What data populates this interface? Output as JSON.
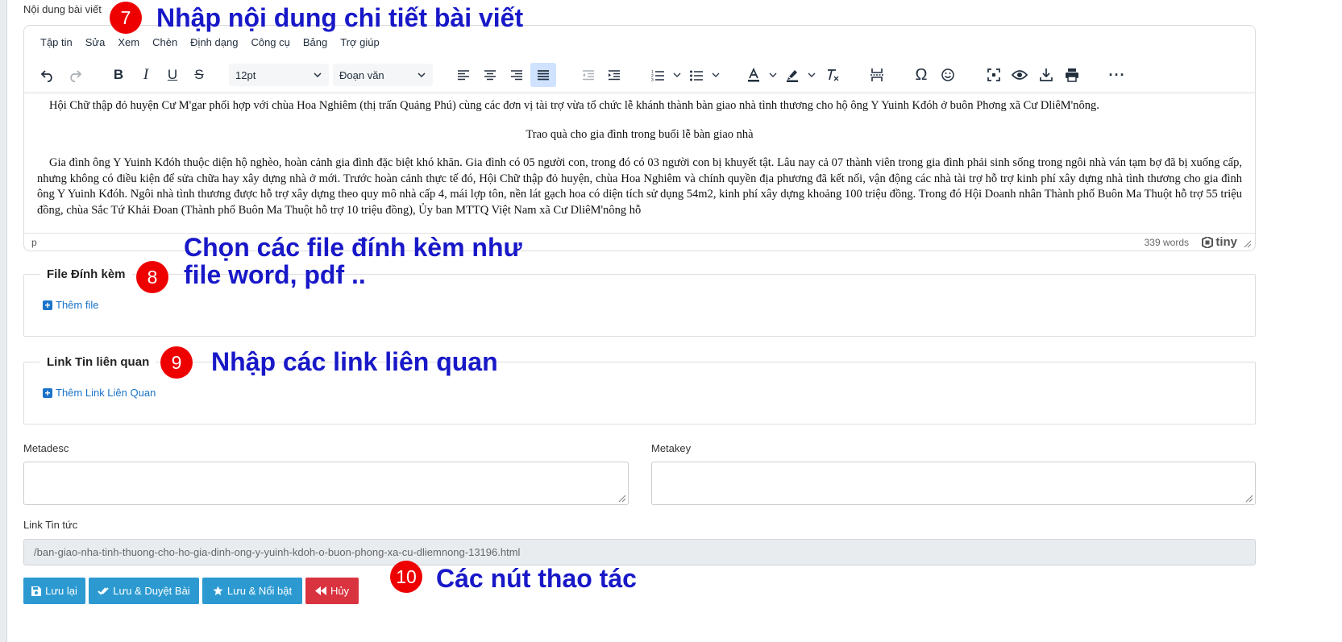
{
  "editor_section": {
    "label": "Nội dung bài viết",
    "menu": [
      "Tập tin",
      "Sửa",
      "Xem",
      "Chèn",
      "Định dạng",
      "Công cụ",
      "Bảng",
      "Trợ giúp"
    ],
    "font_size": "12pt",
    "block_format": "Đoạn văn",
    "toolbar_icons": [
      "undo-icon",
      "redo-icon",
      "bold-icon",
      "italic-icon",
      "underline-icon",
      "strikethrough-icon",
      "align-left-icon",
      "align-center-icon",
      "align-right-icon",
      "align-justify-icon",
      "outdent-icon",
      "indent-icon",
      "numbered-list-icon",
      "bullet-list-icon",
      "text-color-icon",
      "highlight-icon",
      "clear-format-icon",
      "page-break-icon",
      "special-char-icon",
      "emoticon-icon",
      "fullscreen-icon",
      "preview-icon",
      "save-icon",
      "print-icon",
      "more-icon"
    ],
    "paragraphs": [
      "Hội Chữ thập đỏ huyện Cư M'gar phối hợp với chùa Hoa Nghiêm (thị trấn Quảng Phú) cùng các đơn vị tài trợ vừa tổ chức lễ khánh thành bàn giao nhà tình thương cho hộ ông Y Yuinh Kđóh ở buôn Phơng xã Cư DliêM'nông.",
      "Trao quà cho gia đình trong buổi lễ bàn giao nhà",
      "Gia đình ông Y Yuinh Kđóh thuộc diện hộ nghèo, hoàn cảnh gia đình đặc biệt khó khăn. Gia đình có 05 người con, trong đó có 03 người con bị khuyết tật. Lâu nay cả 07 thành viên trong gia đình phải sinh sống trong ngôi nhà ván tạm bợ đã bị xuống cấp, nhưng không có điều kiện để sửa chữa hay xây dựng nhà ở mới. Trước hoàn cảnh thực tế đó, Hội Chữ thập đỏ huyện, chùa Hoa Nghiêm và chính quyền địa phương đã kết nối, vận động các nhà tài trợ hỗ trợ kinh phí xây dựng nhà tình thương cho gia đình ông Y Yuinh Kđóh. Ngôi nhà tình thương được hỗ trợ xây dựng theo quy mô nhà cấp 4, mái lợp tôn, nền lát gạch hoa có diện tích sử dụng 54m2, kinh phí xây dựng khoảng 100 triệu đồng. Trong đó Hội Doanh nhân Thành phố Buôn Ma Thuột hỗ trợ 55 triệu đồng, chùa Sắc Tứ Khải Đoan (Thành phố Buôn Ma Thuột hỗ trợ 10 triệu đồng), Ủy ban MTTQ Việt Nam xã Cư DliêM'nông hỗ"
    ],
    "status_path": "p",
    "word_count": "339 words",
    "brand": "tiny"
  },
  "attachments": {
    "legend": "File Đính kèm",
    "add_label": "Thêm file"
  },
  "related_links": {
    "legend": "Link Tin liên quan",
    "add_label": "Thêm Link Liên Quan"
  },
  "meta": {
    "desc_label": "Metadesc",
    "key_label": "Metakey",
    "desc_value": "",
    "key_value": ""
  },
  "news_link": {
    "label": "Link Tin tức",
    "value": "/ban-giao-nha-tinh-thuong-cho-ho-gia-dinh-ong-y-yuinh-kdoh-o-buon-phong-xa-cu-dliemnong-13196.html"
  },
  "buttons": {
    "save": "Lưu lại",
    "save_approve": "Lưu & Duyệt Bài",
    "save_feature": "Lưu & Nổi bật",
    "cancel": "Hủy"
  },
  "annotations": {
    "n7": "7",
    "t7": "Nhập nội dung chi tiết bài viết",
    "n8": "8",
    "t8a": "Chọn các file đính kèm như",
    "t8b": "file word, pdf ..",
    "n9": "9",
    "t9": "Nhập các link liên quan",
    "n10": "10",
    "t10": "Các nút thao tác"
  },
  "colors": {
    "button_blue": "#2c9ad1",
    "button_red": "#d9333f",
    "annotation_blue": "#1818c8",
    "annotation_badge": "#ee0000",
    "link_blue": "#1a73c8"
  }
}
